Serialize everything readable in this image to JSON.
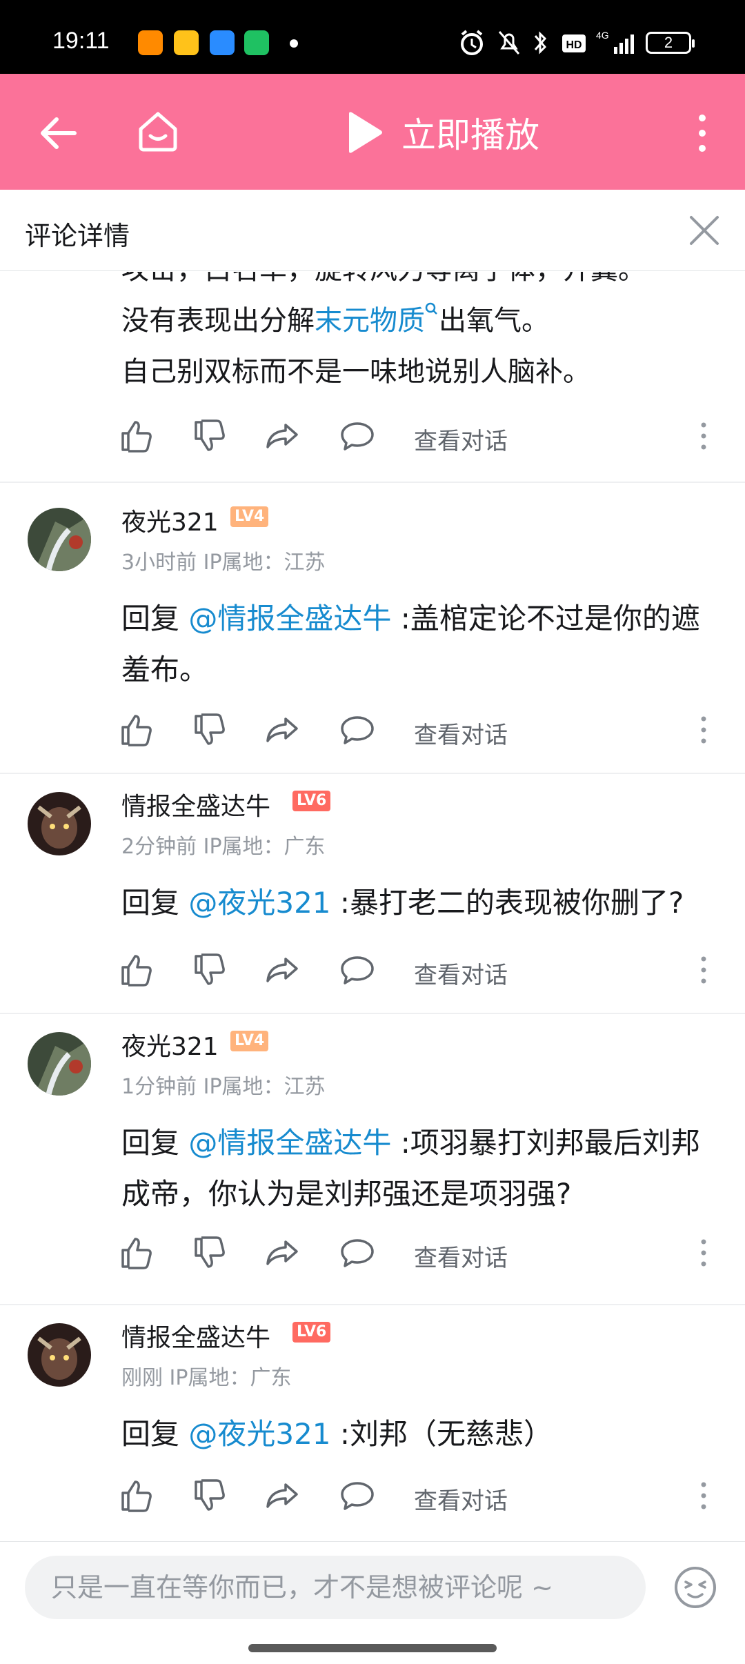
{
  "status_bar": {
    "time": "19:11",
    "battery": "2",
    "network": "4G"
  },
  "toolbar": {
    "play_label": "立即播放"
  },
  "detail": {
    "title": "评论详情"
  },
  "previous_comment": {
    "line1": "攻击，白名单，旋转风力等离子体，开翼。",
    "line2_pre": "没有表现出分解",
    "line2_link": "末元物质",
    "line2_post": "出氧气。",
    "line3": "自己别双标而不是一味地说别人脑补。"
  },
  "action_label": "查看对话",
  "comments": [
    {
      "user": "夜光321",
      "level": "LV4",
      "meta": "3小时前 IP属地：江苏",
      "reply_prefix": "回复 ",
      "at": "@情报全盛达牛",
      "text": " :盖棺定论不过是你的遮羞布。"
    },
    {
      "user": "情报全盛达牛",
      "level": "LV6",
      "meta": "2分钟前 IP属地：广东",
      "reply_prefix": "回复 ",
      "at": "@夜光321",
      "text": " :暴打老二的表现被你删了?"
    },
    {
      "user": "夜光321",
      "level": "LV4",
      "meta": "1分钟前 IP属地：江苏",
      "reply_prefix": "回复 ",
      "at": "@情报全盛达牛",
      "text": " :项羽暴打刘邦最后刘邦成帝，你认为是刘邦强还是项羽强?"
    },
    {
      "user": "情报全盛达牛",
      "level": "LV6",
      "meta": "刚刚 IP属地：广东",
      "reply_prefix": "回复 ",
      "at": "@夜光321",
      "text": " :刘邦（无慈悲）"
    }
  ],
  "input": {
    "placeholder": "只是一直在等你而已，才不是想被评论呢 ~"
  },
  "colors": {
    "brand_pink": "#fb7299",
    "link_blue": "#178bcf"
  }
}
